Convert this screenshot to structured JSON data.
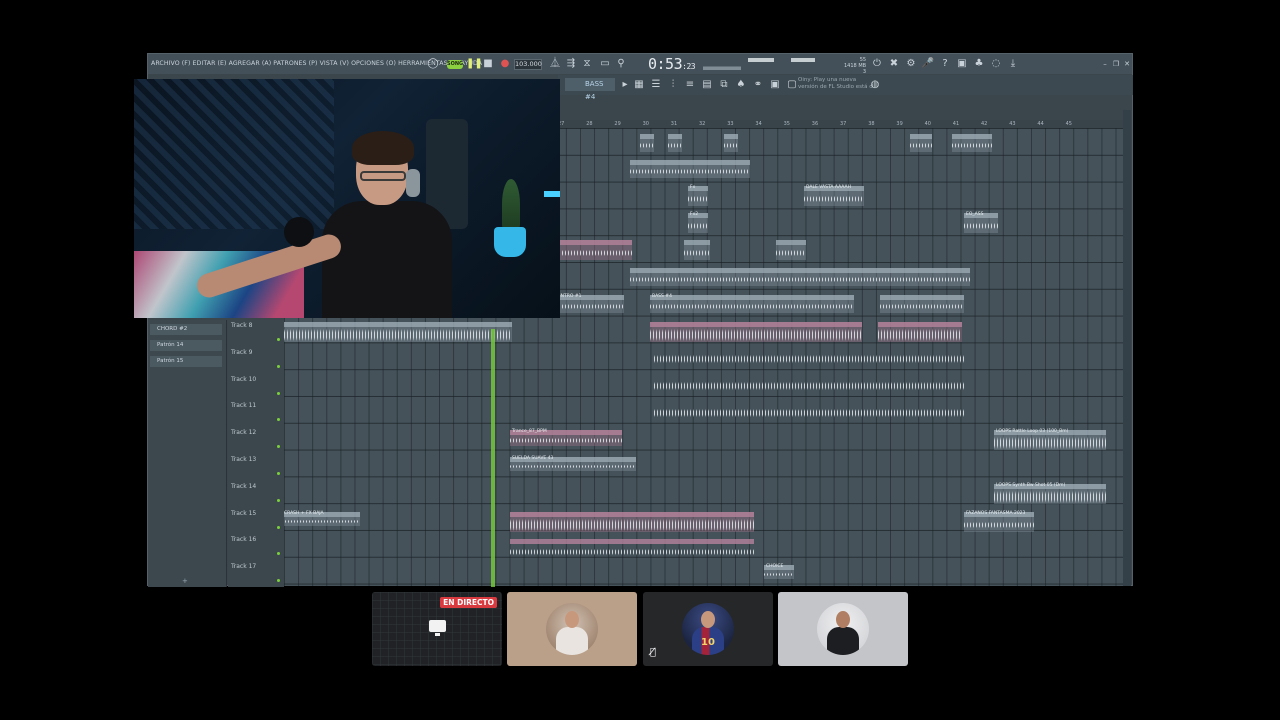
{
  "fl_studio": {
    "menu": "ARCHIVO (F) EDITAR (E) AGREGAR (A) PATRONES (P) VISTA (V) OPCIONES (O) HERRAMIENTAS (T) AYUDA",
    "mode": "SONG",
    "tempo": "103.000",
    "time_main": "0:53",
    "time_sub": "23",
    "cpu_line1": "55",
    "cpu_line2": "1418 MB",
    "cpu_line3": "3",
    "pattern_name": "BASS #4",
    "hint_line1": "Oiny: Play una nueva",
    "hint_line2": "versión de FL Studio está d.",
    "ruler_numbers": [
      "27",
      "28",
      "29",
      "30",
      "31",
      "32",
      "33",
      "34",
      "35",
      "36",
      "37",
      "38",
      "39",
      "40",
      "41",
      "42",
      "43",
      "44",
      "45"
    ],
    "browser_items": [
      "CHORD #2",
      "Patrón 14",
      "Patrón 15"
    ],
    "tracks": [
      "Track 8",
      "Track 9",
      "Track 10",
      "Track 11",
      "Track 12",
      "Track 13",
      "Track 14",
      "Track 15",
      "Track 16",
      "Track 17"
    ],
    "clip_labels": {
      "dale_vasta": "DALE VASTA AAAAH",
      "eo_ass": "EO_ASS",
      "fx1": "Fx",
      "fx2": "Fx2",
      "bass_intro": "BASS INTRO #1",
      "bass4": "BASS #4",
      "trance": "Trance_87_BPM",
      "suelda": "SUELDA SUAVE 43",
      "crash": "CRASH + FX BAJA",
      "loop": "LOOPS Rattle Loop 03 (100_Bm)",
      "loop2": "LOOPS Synth Bw Shot 05 (Dm)",
      "fantasma": "FAZANOS FANTASMA 2023",
      "choice": "CHOICE"
    },
    "colors": {
      "accent_green": "#7bd13a",
      "live_red": "#d93a3f"
    }
  },
  "call": {
    "live_badge": "EN DIRECTO",
    "tile3_number": "10"
  }
}
